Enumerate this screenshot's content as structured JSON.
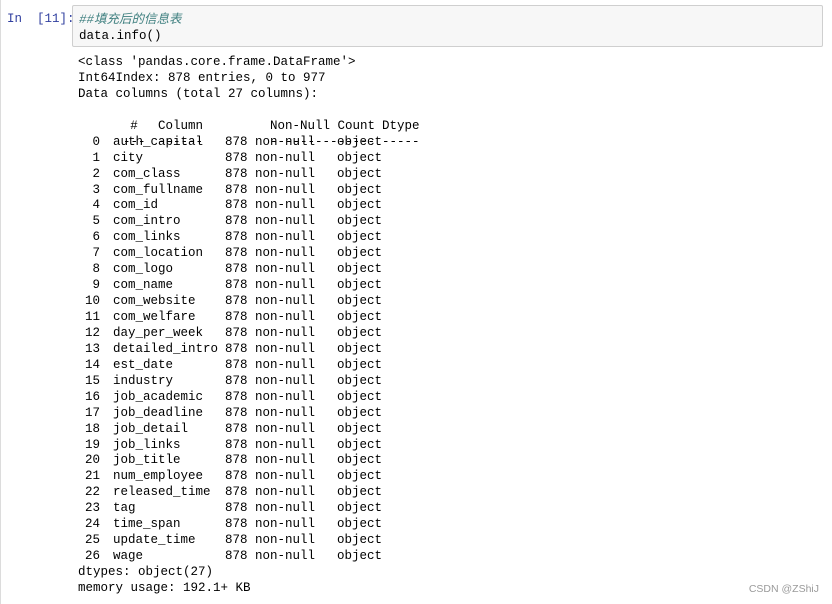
{
  "cell": {
    "prompt": "In  [11]:",
    "code_comment": "##填充后的信息表",
    "code_call": "data.info()"
  },
  "output": {
    "class_line": "<class 'pandas.core.frame.DataFrame'>",
    "index_line": "Int64Index: 878 entries, 0 to 977",
    "columns_line": "Data columns (total 27 columns):",
    "header": {
      "idx": "#",
      "column": "Column",
      "count": "Non-Null Count",
      "dtype": "Dtype"
    },
    "separator": {
      "idx": "---",
      "column": "------",
      "count": "--------------",
      "dtype": "-----"
    },
    "rows": [
      {
        "idx": "0",
        "column": "auth_capital",
        "count": "878 non-null",
        "dtype": "object"
      },
      {
        "idx": "1",
        "column": "city",
        "count": "878 non-null",
        "dtype": "object"
      },
      {
        "idx": "2",
        "column": "com_class",
        "count": "878 non-null",
        "dtype": "object"
      },
      {
        "idx": "3",
        "column": "com_fullname",
        "count": "878 non-null",
        "dtype": "object"
      },
      {
        "idx": "4",
        "column": "com_id",
        "count": "878 non-null",
        "dtype": "object"
      },
      {
        "idx": "5",
        "column": "com_intro",
        "count": "878 non-null",
        "dtype": "object"
      },
      {
        "idx": "6",
        "column": "com_links",
        "count": "878 non-null",
        "dtype": "object"
      },
      {
        "idx": "7",
        "column": "com_location",
        "count": "878 non-null",
        "dtype": "object"
      },
      {
        "idx": "8",
        "column": "com_logo",
        "count": "878 non-null",
        "dtype": "object"
      },
      {
        "idx": "9",
        "column": "com_name",
        "count": "878 non-null",
        "dtype": "object"
      },
      {
        "idx": "10",
        "column": "com_website",
        "count": "878 non-null",
        "dtype": "object"
      },
      {
        "idx": "11",
        "column": "com_welfare",
        "count": "878 non-null",
        "dtype": "object"
      },
      {
        "idx": "12",
        "column": "day_per_week",
        "count": "878 non-null",
        "dtype": "object"
      },
      {
        "idx": "13",
        "column": "detailed_intro",
        "count": "878 non-null",
        "dtype": "object"
      },
      {
        "idx": "14",
        "column": "est_date",
        "count": "878 non-null",
        "dtype": "object"
      },
      {
        "idx": "15",
        "column": "industry",
        "count": "878 non-null",
        "dtype": "object"
      },
      {
        "idx": "16",
        "column": "job_academic",
        "count": "878 non-null",
        "dtype": "object"
      },
      {
        "idx": "17",
        "column": "job_deadline",
        "count": "878 non-null",
        "dtype": "object"
      },
      {
        "idx": "18",
        "column": "job_detail",
        "count": "878 non-null",
        "dtype": "object"
      },
      {
        "idx": "19",
        "column": "job_links",
        "count": "878 non-null",
        "dtype": "object"
      },
      {
        "idx": "20",
        "column": "job_title",
        "count": "878 non-null",
        "dtype": "object"
      },
      {
        "idx": "21",
        "column": "num_employee",
        "count": "878 non-null",
        "dtype": "object"
      },
      {
        "idx": "22",
        "column": "released_time",
        "count": "878 non-null",
        "dtype": "object"
      },
      {
        "idx": "23",
        "column": "tag",
        "count": "878 non-null",
        "dtype": "object"
      },
      {
        "idx": "24",
        "column": "time_span",
        "count": "878 non-null",
        "dtype": "object"
      },
      {
        "idx": "25",
        "column": "update_time",
        "count": "878 non-null",
        "dtype": "object"
      },
      {
        "idx": "26",
        "column": "wage",
        "count": "878 non-null",
        "dtype": "object"
      }
    ],
    "dtypes_line": "dtypes: object(27)",
    "memory_line": "memory usage: 192.1+ KB"
  },
  "watermark": "CSDN @ZShiJ"
}
